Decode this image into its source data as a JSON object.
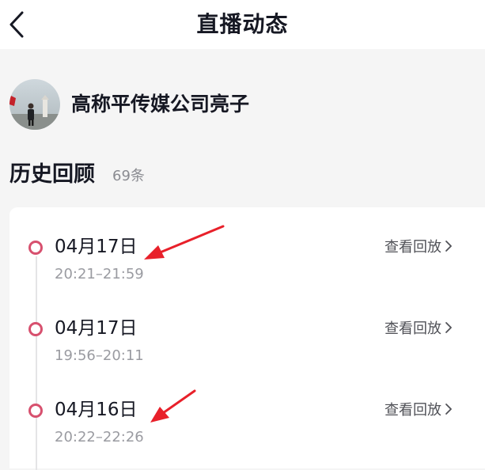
{
  "header": {
    "title": "直播动态",
    "back_icon": "chevron-left-icon"
  },
  "profile": {
    "name": "高称平传媒公司亮子"
  },
  "history": {
    "title": "历史回顾",
    "count": "69条"
  },
  "records": [
    {
      "date": "04月17日",
      "time": "20:21–21:59",
      "action": "查看回放"
    },
    {
      "date": "04月17日",
      "time": "19:56–20:11",
      "action": "查看回放"
    },
    {
      "date": "04月16日",
      "time": "20:22–22:26",
      "action": "查看回放"
    }
  ],
  "colors": {
    "accent_dot": "#d7506e",
    "annotation_arrow": "#e8202a"
  }
}
